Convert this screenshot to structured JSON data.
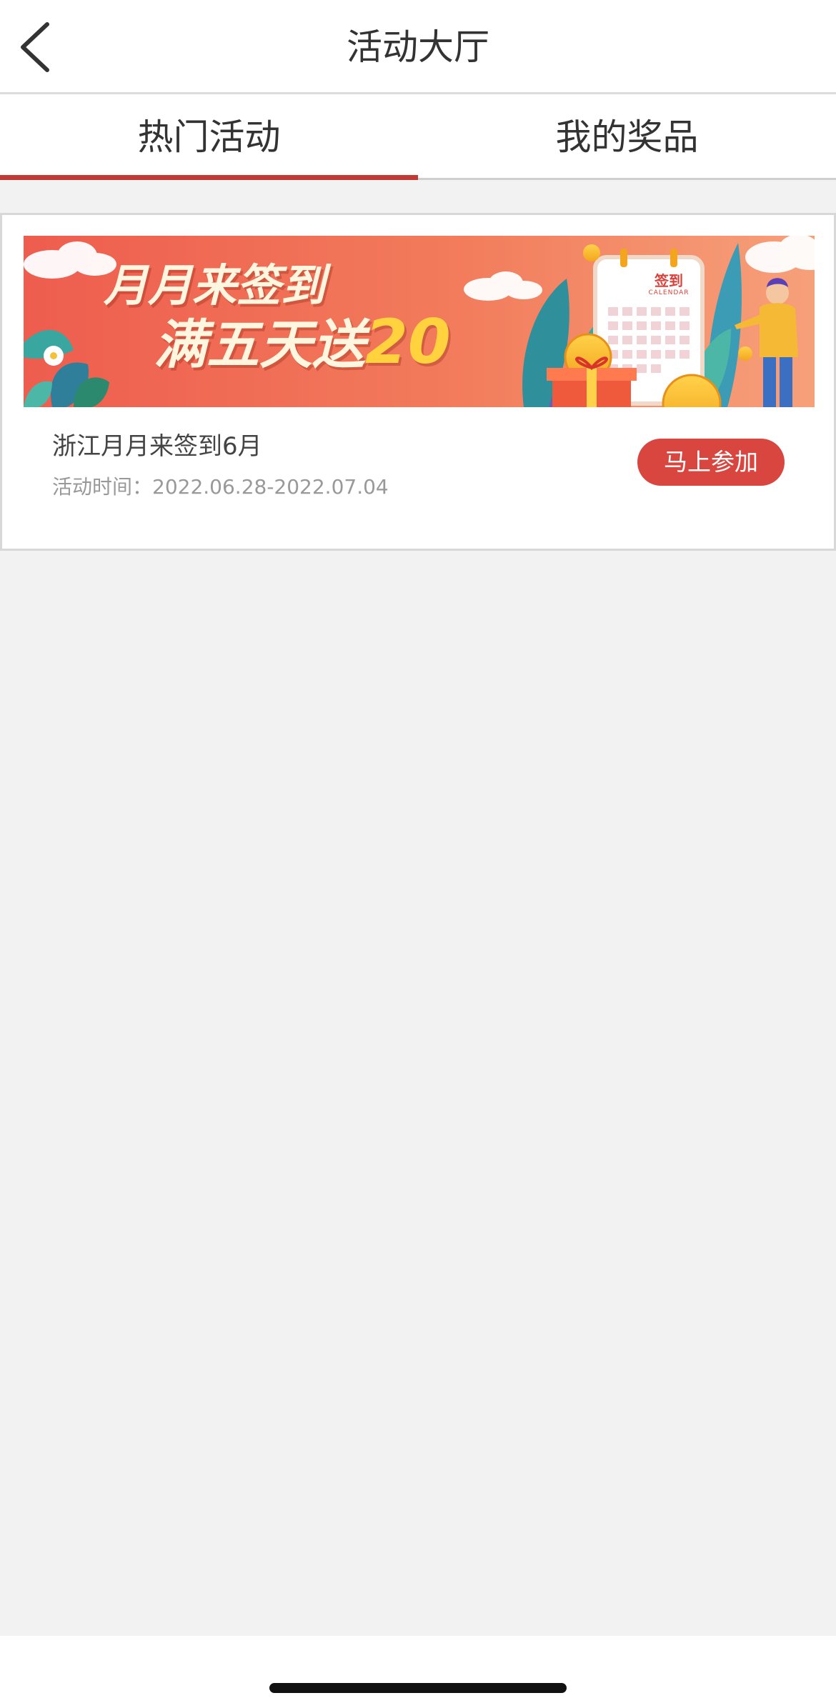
{
  "navbar": {
    "title": "活动大厅",
    "back_icon": "chevron-left-icon"
  },
  "tabs": [
    {
      "label": "热门活动",
      "active": true
    },
    {
      "label": "我的奖品",
      "active": false
    }
  ],
  "colors": {
    "accent": "#c23a35",
    "button": "#d9463f",
    "background": "#f2f2f2"
  },
  "activities": [
    {
      "banner": {
        "line1": "月月来签到",
        "line2_text": "满五天送",
        "line2_number": "20",
        "calendar_title": "签到",
        "calendar_sub": "CALENDAR"
      },
      "title": "浙江月月来签到6月",
      "time": "活动时间：2022.06.28-2022.07.04",
      "button_label": "马上参加"
    }
  ]
}
